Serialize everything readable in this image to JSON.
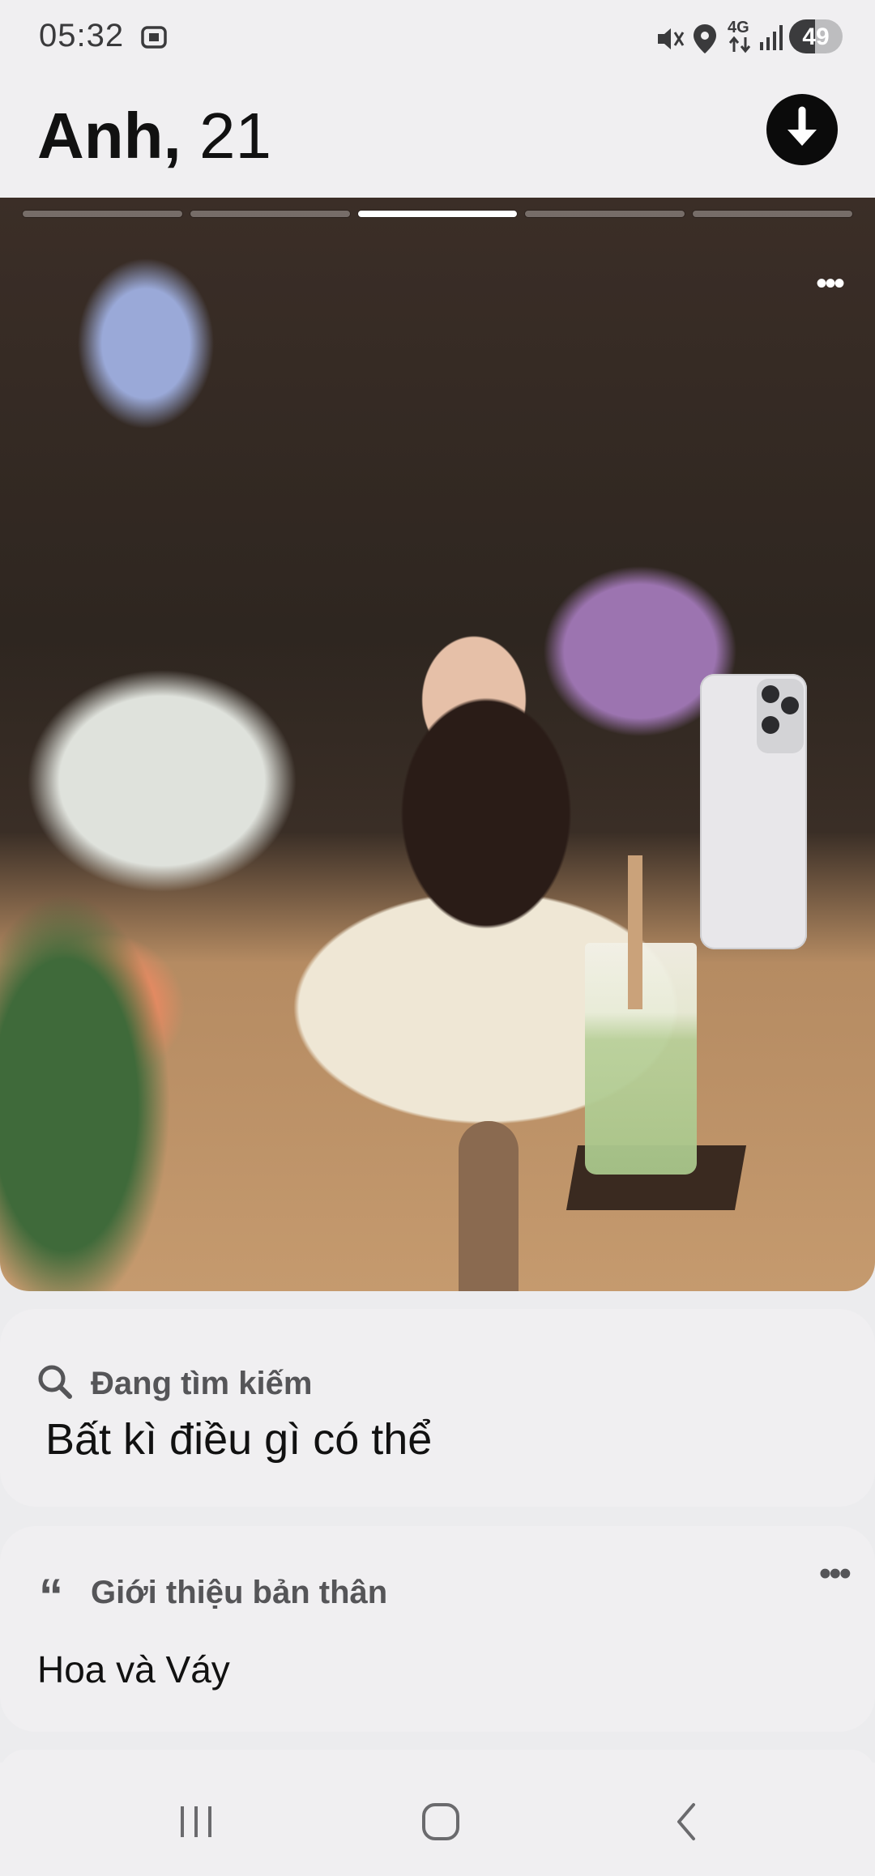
{
  "status_bar": {
    "time": "05:32",
    "network": "4G",
    "battery": "49",
    "battery_level": 0.49
  },
  "header": {
    "name": "Anh,",
    "age": "21"
  },
  "photo": {
    "segment_count": 5,
    "active_segment": 3
  },
  "looking_for": {
    "label": "Đang tìm kiếm",
    "value": "Bất kì điều gì có thể"
  },
  "about": {
    "label": "Giới thiệu bản thân",
    "value": "Hoa và Váy"
  },
  "icons": {
    "screenshot": "screenshot-icon",
    "mute": "vibrate-mute-icon",
    "location": "location-icon",
    "signal": "signal-icon",
    "download": "download-icon",
    "search": "search-icon",
    "quote": "quote-icon",
    "more": "more-icon",
    "recents": "recents-icon",
    "home": "home-icon",
    "back": "back-icon"
  }
}
